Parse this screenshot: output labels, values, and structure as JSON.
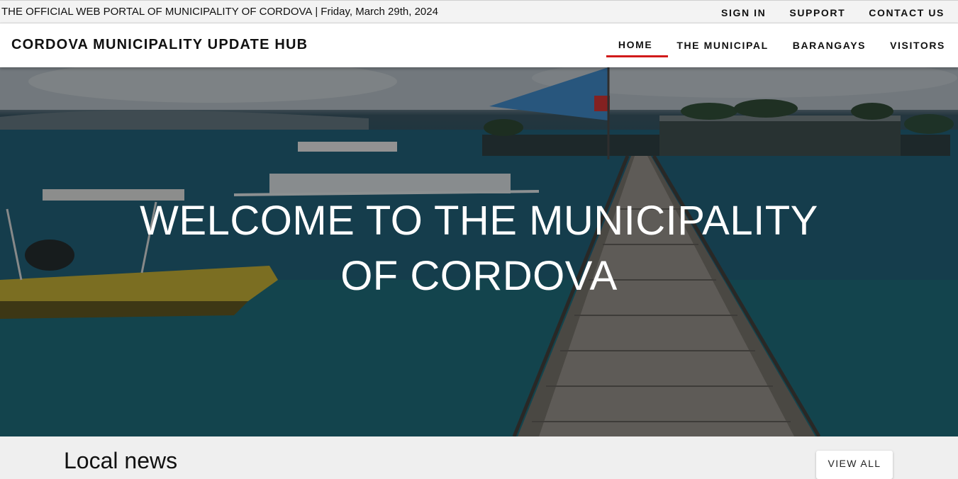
{
  "topbar": {
    "portal_title": "THE OFFICIAL WEB PORTAL OF MUNICIPALITY OF CORDOVA",
    "separator": "|",
    "date": "Friday, March 29th, 2024",
    "links": [
      "SIGN IN",
      "SUPPORT",
      "CONTACT US"
    ]
  },
  "header": {
    "brand": "CORDOVA MUNICIPALITY UPDATE HUB",
    "nav": [
      "HOME",
      "THE MUNICIPAL",
      "BARANGAYS",
      "VISITORS"
    ],
    "active_nav": "HOME"
  },
  "hero": {
    "line1": "WELCOME TO THE MUNICIPALITY",
    "line2": "OF CORDOVA"
  },
  "news": {
    "heading": "Local news",
    "view_all": "VIEW ALL"
  },
  "colors": {
    "accent": "#d11a1a",
    "topbar_bg": "#f3f3f3",
    "header_bg": "#ffffff"
  }
}
